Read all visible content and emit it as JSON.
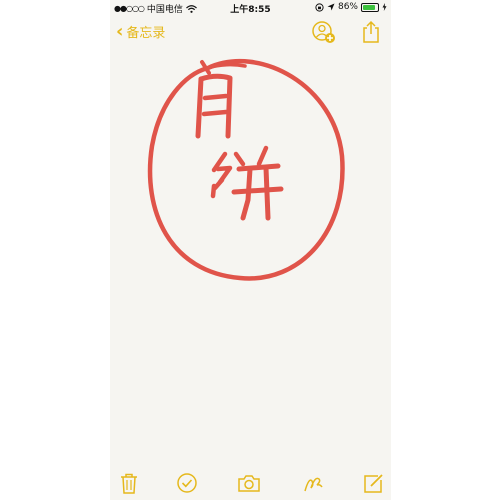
{
  "status_bar": {
    "signal": "●●○○○",
    "carrier": "中国电信",
    "time": "上午8:55",
    "battery_percent": "86%",
    "battery_level": 0.86,
    "battery_color": "#3cc13c"
  },
  "nav": {
    "back_label": "备忘录"
  },
  "drawing": {
    "ink_color": "#e0544a",
    "handwritten_text": "月饼"
  },
  "toolbar": {
    "items": [
      "trash",
      "checklist",
      "camera",
      "sketch",
      "compose"
    ]
  },
  "colors": {
    "accent": "#e5b81c",
    "paper": "#f6f5f1"
  }
}
